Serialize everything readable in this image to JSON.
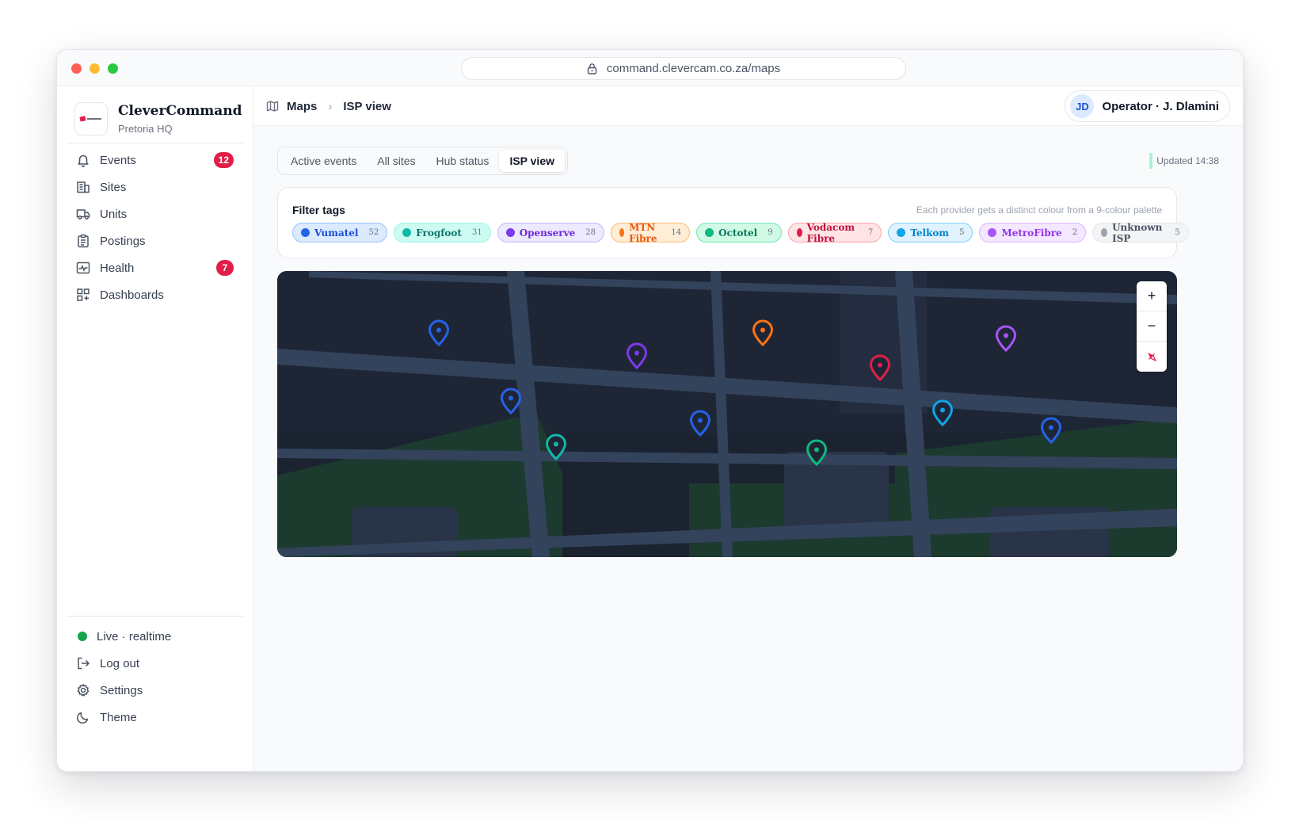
{
  "browser": {
    "url": "command.clevercam.co.za/maps"
  },
  "brand": {
    "name": "CleverCommand",
    "subtitle": "Pretoria HQ"
  },
  "nav": [
    {
      "label": "Events",
      "icon": "bell-icon",
      "badge": "12"
    },
    {
      "label": "Sites",
      "icon": "building-icon"
    },
    {
      "label": "Units",
      "icon": "truck-icon"
    },
    {
      "label": "Postings",
      "icon": "clipboard-icon"
    },
    {
      "label": "Health",
      "icon": "pulse-icon",
      "badge": "7"
    },
    {
      "label": "Dashboards",
      "icon": "grid-icon"
    }
  ],
  "footer": {
    "live": "Live · realtime",
    "logout": "Log out",
    "settings": "Settings",
    "theme": "Theme"
  },
  "breadcrumb": {
    "root": "Maps",
    "current": "ISP view"
  },
  "user": {
    "initials": "JD",
    "name": "Operator · J. Dlamini"
  },
  "tabs": [
    "Active events",
    "All sites",
    "Hub status",
    "ISP view"
  ],
  "active_tab": "ISP view",
  "updated": "Updated 14:38",
  "filters": {
    "title": "Filter tags",
    "note": "Each provider gets a distinct colour from a 9-colour palette",
    "chips": [
      {
        "label": "Vumatel",
        "count": "52",
        "color": "#2563eb",
        "bg": "#dbeafe",
        "border": "#93c5fd",
        "text": "#1d4ed8"
      },
      {
        "label": "Frogfoot",
        "count": "31",
        "color": "#14b8a6",
        "bg": "#ccfbf1",
        "border": "#99f6e4",
        "text": "#0f766e"
      },
      {
        "label": "Openserve",
        "count": "28",
        "color": "#7c3aed",
        "bg": "#ede9fe",
        "border": "#c4b5fd",
        "text": "#6d28d9"
      },
      {
        "label": "MTN Fibre",
        "count": "14",
        "color": "#f97316",
        "bg": "#ffedd5",
        "border": "#fdba74",
        "text": "#ea580c"
      },
      {
        "label": "Octotel",
        "count": "9",
        "color": "#10b981",
        "bg": "#d1fae5",
        "border": "#6ee7b7",
        "text": "#047857"
      },
      {
        "label": "Vodacom Fibre",
        "count": "7",
        "color": "#e11d48",
        "bg": "#ffe4e6",
        "border": "#fda4af",
        "text": "#be123c"
      },
      {
        "label": "Telkom",
        "count": "5",
        "color": "#0ea5e9",
        "bg": "#e0f2fe",
        "border": "#7dd3fc",
        "text": "#0284c7"
      },
      {
        "label": "MetroFibre",
        "count": "2",
        "color": "#a855f7",
        "bg": "#f3e8ff",
        "border": "#d8b4fe",
        "text": "#9333ea"
      },
      {
        "label": "Unknown ISP",
        "count": "5",
        "color": "#9ca3af",
        "bg": "#f3f4f6",
        "border": "#e5e7eb",
        "text": "#4b5563"
      }
    ]
  },
  "map": {
    "pins": [
      {
        "provider": "Vumatel",
        "color": "#2563eb"
      },
      {
        "provider": "Openserve",
        "color": "#7c3aed"
      },
      {
        "provider": "MTN Fibre",
        "color": "#f97316"
      },
      {
        "provider": "Vodacom Fibre",
        "color": "#e11d48"
      },
      {
        "provider": "MetroFibre",
        "color": "#a855f7"
      },
      {
        "provider": "Vumatel",
        "color": "#2563eb"
      },
      {
        "provider": "Vumatel",
        "color": "#2563eb"
      },
      {
        "provider": "Frogfoot",
        "color": "#14b8a6"
      },
      {
        "provider": "Octotel",
        "color": "#10b981"
      },
      {
        "provider": "Telkom",
        "color": "#0ea5e9"
      },
      {
        "provider": "Vumatel",
        "color": "#2563eb"
      }
    ],
    "controls": {
      "zoom_in": "+",
      "zoom_out": "−"
    }
  }
}
